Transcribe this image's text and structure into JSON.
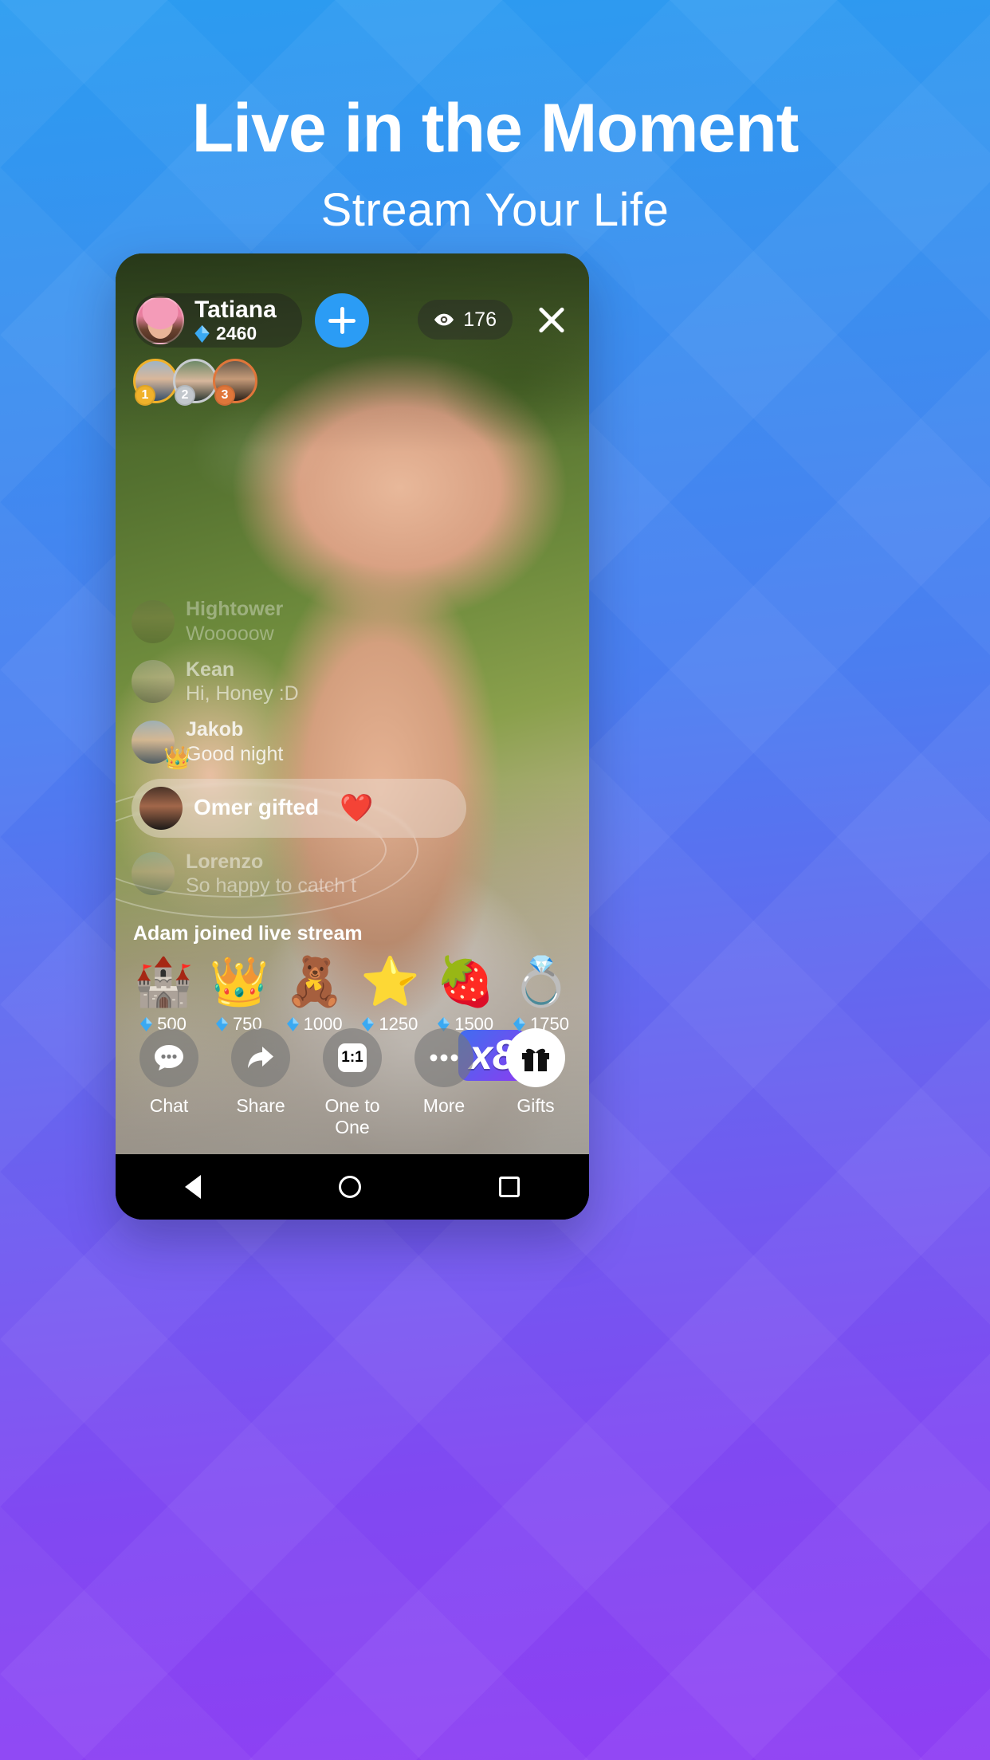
{
  "promo": {
    "headline": "Live in the Moment",
    "subheadline": "Stream Your Life"
  },
  "colors": {
    "accent_blue": "#2b9cf5",
    "bg_top": "#2b9cf0",
    "bg_bottom": "#8f3ff3",
    "rank_gold": "#f0b12a",
    "rank_silver": "#c2c7cc",
    "rank_bronze": "#e0763a"
  },
  "stream": {
    "streamer": {
      "name": "Tatiana",
      "coins": "2460",
      "coin_icon": "diamond-icon",
      "follow_label": "+"
    },
    "viewers": {
      "icon": "eye-icon",
      "count": "176"
    },
    "close_icon": "close-icon",
    "leaderboard": [
      {
        "rank": "1"
      },
      {
        "rank": "2"
      },
      {
        "rank": "3"
      }
    ],
    "chat": [
      {
        "name": "Hightower",
        "message": "Wooooow"
      },
      {
        "name": "Kean",
        "message": "Hi, Honey :D"
      },
      {
        "name": "Jakob",
        "message": "Good night",
        "badge": "👑"
      },
      {
        "name": "Omer gifted",
        "message": "",
        "emoji": "❤️",
        "highlight": true
      },
      {
        "name": "Lorenzo",
        "message": "So happy to catch t"
      }
    ],
    "gift_multiplier": "x8",
    "system_message": "Adam joined live stream",
    "gifts": [
      {
        "icon": "🏰",
        "name": "castle-gift",
        "price": "500"
      },
      {
        "icon": "👑",
        "name": "crown-gift",
        "price": "750"
      },
      {
        "icon": "🧸",
        "name": "teddy-gift",
        "price": "1000"
      },
      {
        "icon": "⭐",
        "name": "star-gift",
        "price": "1250"
      },
      {
        "icon": "🍓",
        "name": "strawberry-gift",
        "price": "1500"
      },
      {
        "icon": "💍",
        "name": "ring-gift",
        "price": "1750"
      }
    ],
    "actions": [
      {
        "label": "Chat",
        "icon": "chat-bubble-icon"
      },
      {
        "label": "Share",
        "icon": "share-arrow-icon"
      },
      {
        "label": "One to One",
        "icon": "one-to-one-icon",
        "icon_text": "1:1"
      },
      {
        "label": "More",
        "icon": "more-dots-icon"
      },
      {
        "label": "Gifts",
        "icon": "gift-box-icon"
      }
    ]
  },
  "navbar": {
    "back": "back-triangle-icon",
    "home": "home-circle-icon",
    "recents": "recents-square-icon"
  }
}
